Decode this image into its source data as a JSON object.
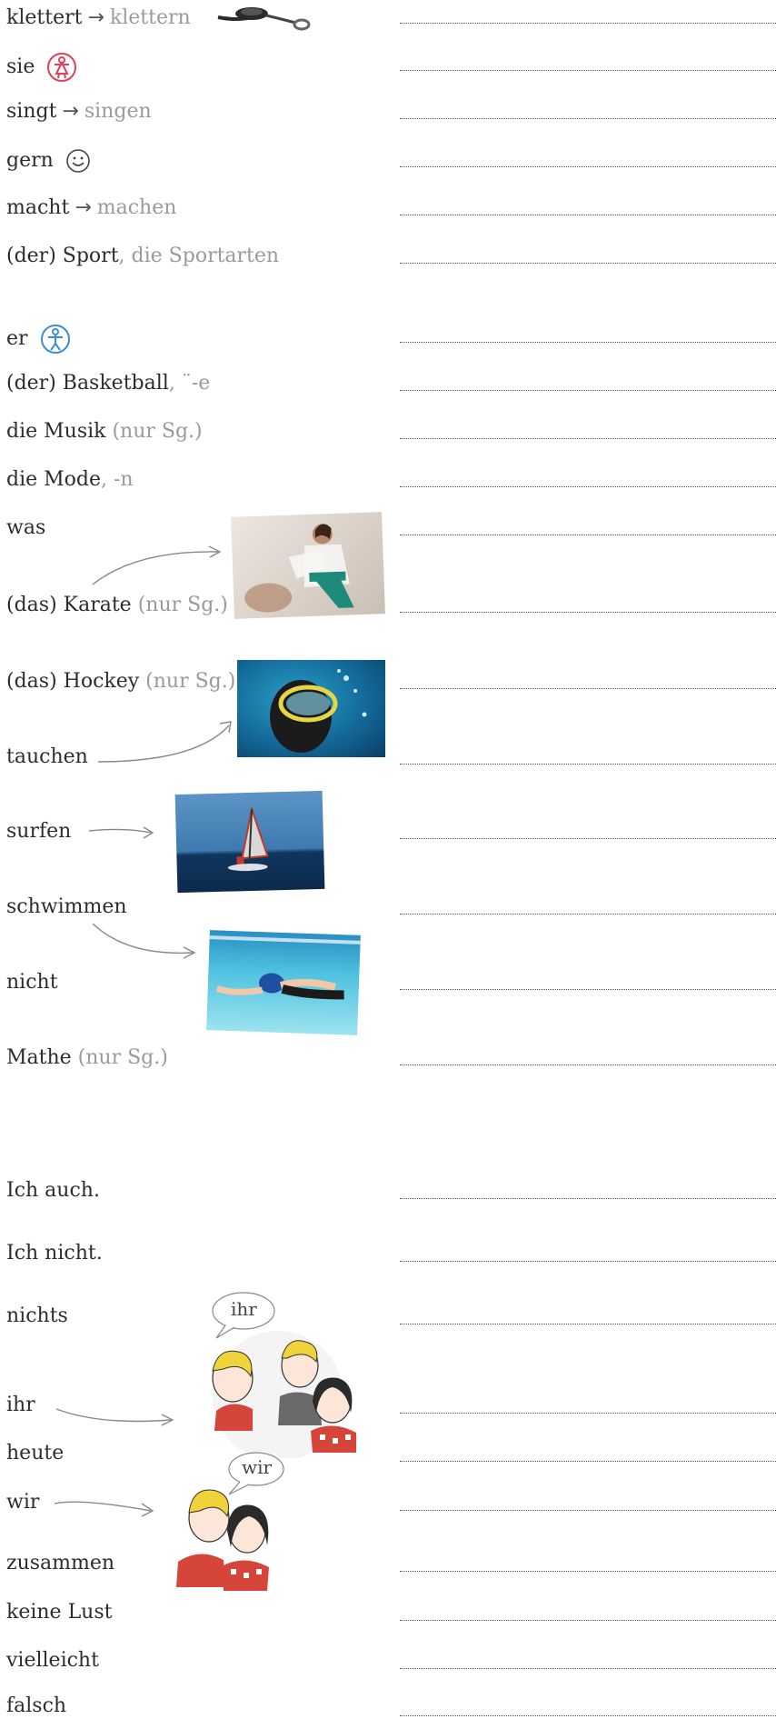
{
  "vocabulary": [
    {
      "word": "klettert",
      "arrow": "→",
      "grey": "klettern"
    },
    {
      "word": "sie",
      "grey": ""
    },
    {
      "word": "singt",
      "arrow": "→",
      "grey": "singen"
    },
    {
      "word": "gern",
      "grey": ""
    },
    {
      "word": "macht",
      "arrow": "→",
      "grey": "machen"
    },
    {
      "word": "(der) Sport",
      "grey": ", die Sportarten"
    },
    {
      "word": "er",
      "grey": ""
    },
    {
      "word": "(der) Basketball",
      "grey": ", ¨-e"
    },
    {
      "word": "die Musik",
      "grey": " (nur Sg.)"
    },
    {
      "word": "die Mode",
      "grey": ", -n"
    },
    {
      "word": "was",
      "grey": ""
    },
    {
      "word": "(das) Karate",
      "grey": " (nur Sg.)"
    },
    {
      "word": "(das) Hockey",
      "grey": " (nur Sg.)"
    },
    {
      "word": "tauchen",
      "grey": ""
    },
    {
      "word": "surfen",
      "grey": ""
    },
    {
      "word": "schwimmen",
      "grey": ""
    },
    {
      "word": "nicht",
      "grey": ""
    },
    {
      "word": "Mathe",
      "grey": " (nur Sg.)"
    },
    {
      "word": "Ich auch.",
      "grey": ""
    },
    {
      "word": "Ich nicht.",
      "grey": ""
    },
    {
      "word": "nichts",
      "grey": ""
    },
    {
      "word": "ihr",
      "grey": ""
    },
    {
      "word": "heute",
      "grey": ""
    },
    {
      "word": "wir",
      "grey": ""
    },
    {
      "word": "zusammen",
      "grey": ""
    },
    {
      "word": "keine Lust",
      "grey": ""
    },
    {
      "word": "vielleicht",
      "grey": ""
    },
    {
      "word": "falsch",
      "grey": ""
    }
  ],
  "bubbles": {
    "ihr": "ihr",
    "wir": "wir"
  },
  "colors": {
    "sie_icon": "#e0405a",
    "er_icon": "#3a8fd0"
  }
}
